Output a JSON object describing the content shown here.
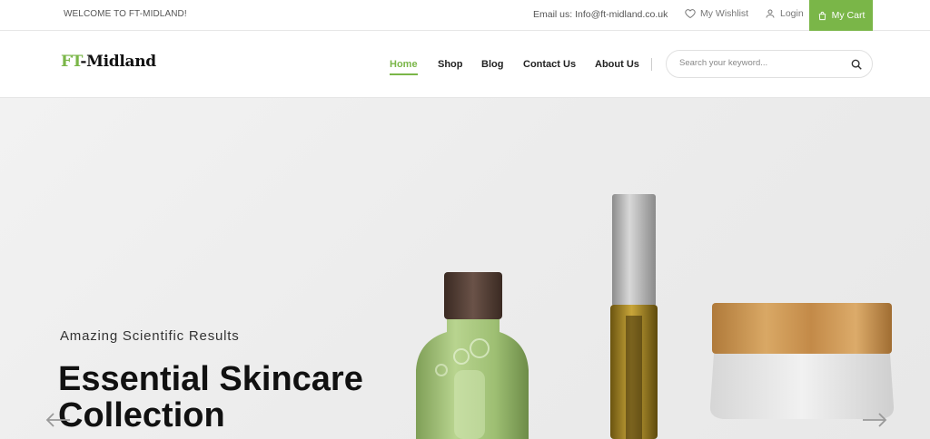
{
  "topbar": {
    "welcome": "WELCOME TO FT-MIDLAND!",
    "email": "Email us: Info@ft-midland.co.uk",
    "wishlist": "My Wishlist",
    "login": "Login",
    "cart": "My Cart"
  },
  "header": {
    "logo_ft": "FT",
    "logo_rest": "-Midland",
    "nav": [
      "Home",
      "Shop",
      "Blog",
      "Contact Us",
      "About Us"
    ],
    "active_nav": "Home",
    "search_placeholder": "Search your keyword..."
  },
  "hero": {
    "subtitle": "Amazing Scientific Results",
    "title": "Essential Skincare Collection"
  },
  "colors": {
    "accent": "#7ab648"
  },
  "icons": [
    "heart-icon",
    "user-icon",
    "shopping-bag-icon",
    "search-icon",
    "arrow-left-icon",
    "arrow-right-icon"
  ]
}
